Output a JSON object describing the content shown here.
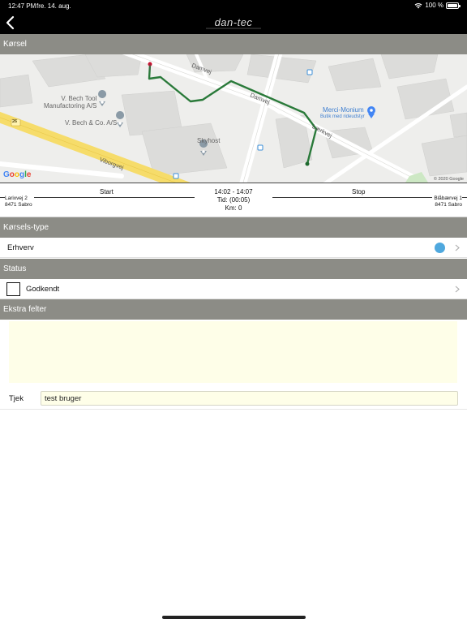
{
  "status_bar": {
    "time": "12:47 PM",
    "date": "fre. 14. aug.",
    "battery": "100 %"
  },
  "header": {
    "logo_text": "dan-tec"
  },
  "sections": {
    "trip": "Kørsel",
    "trip_type": "Kørsels-type",
    "status": "Status",
    "extra": "Ekstra felter"
  },
  "map": {
    "streets": [
      "Damvej",
      "Damvej",
      "Viborgvej",
      "Lærkvej"
    ],
    "road_number": "26",
    "places": [
      {
        "name": "V. Bech Tool\nManufactoring A/S"
      },
      {
        "name": "V. Bech & Co. A/S"
      },
      {
        "name": "Skyhost"
      },
      {
        "name": "Merci-Monium",
        "sub": "Butik med rideudstyr"
      }
    ],
    "logo": "Google",
    "copyright": "© 2020 Google"
  },
  "trip": {
    "start_label": "Start",
    "stop_label": "Stop",
    "time_range": "14:02  -  14:07",
    "duration": "Tid:  (00:05)",
    "km": "Km:  0",
    "start_address": [
      "Larixvej 2",
      "8471 Sabro"
    ],
    "stop_address": [
      "Blåbærvej 1",
      "8471 Sabro"
    ]
  },
  "trip_type": {
    "value": "Erhverv",
    "indicator_color": "#4fa8de"
  },
  "status": {
    "label": "Godkendt",
    "checked": false
  },
  "extra_fields": [
    {
      "label": "Tjek",
      "value": "test bruger"
    }
  ],
  "colors": {
    "route": "#2a7a3a",
    "header_bg": "#000000",
    "section_bg": "#8c8c86",
    "field_bg": "#fefee8"
  }
}
